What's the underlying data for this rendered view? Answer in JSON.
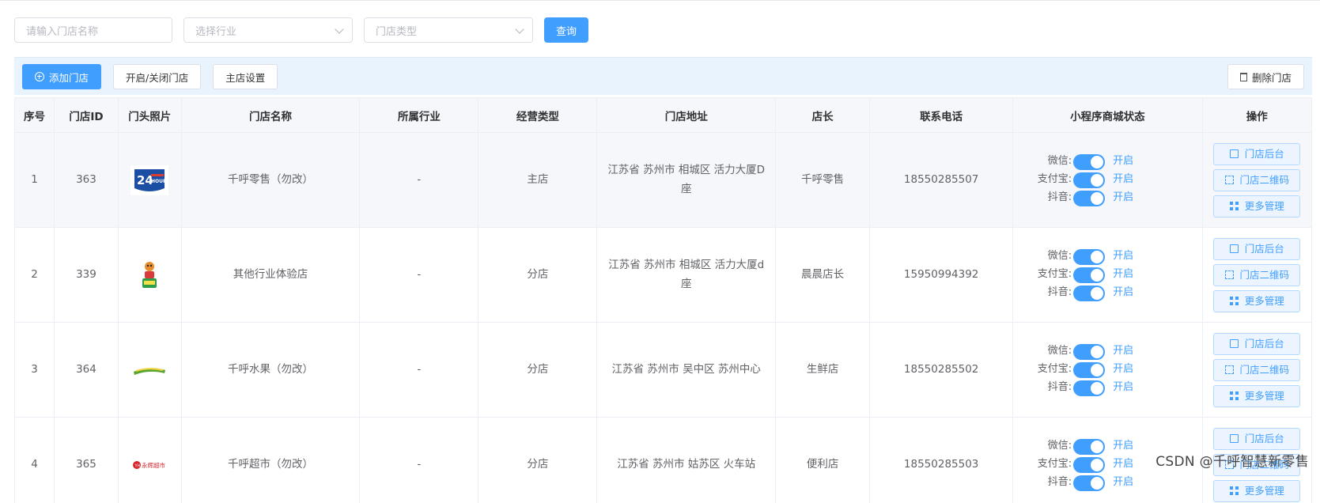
{
  "search": {
    "store_name_placeholder": "请输入门店名称",
    "industry_placeholder": "选择行业",
    "type_placeholder": "门店类型",
    "query_label": "查询"
  },
  "toolbar": {
    "add_label": "添加门店",
    "toggle_label": "开启/关闭门店",
    "main_store_label": "主店设置",
    "delete_label": "删除门店"
  },
  "table": {
    "headers": [
      "序号",
      "门店ID",
      "门头照片",
      "门店名称",
      "所属行业",
      "经营类型",
      "门店地址",
      "店长",
      "联系电话",
      "小程序商城状态",
      "操作"
    ],
    "rows": [
      {
        "no": "1",
        "id": "363",
        "name": "千呼零售（勿改）",
        "industry": "-",
        "type": "主店",
        "address": "江苏省 苏州市 相城区 活力大厦D座",
        "manager": "千呼零售",
        "phone": "18550285507"
      },
      {
        "no": "2",
        "id": "339",
        "name": "其他行业体验店",
        "industry": "-",
        "type": "分店",
        "address": "江苏省 苏州市 相城区 活力大厦d座",
        "manager": "晨晨店长",
        "phone": "15950994392"
      },
      {
        "no": "3",
        "id": "364",
        "name": "千呼水果（勿改）",
        "industry": "-",
        "type": "分店",
        "address": "江苏省 苏州市 吴中区 苏州中心",
        "manager": "生鲜店",
        "phone": "18550285502"
      },
      {
        "no": "4",
        "id": "365",
        "name": "千呼超市（勿改）",
        "industry": "-",
        "type": "分店",
        "address": "江苏省 苏州市 姑苏区 火车站",
        "manager": "便利店",
        "phone": "18550285503"
      }
    ],
    "status_labels": {
      "wechat": "微信:",
      "alipay": "支付宝:",
      "douyin": "抖音:",
      "on": "开启"
    },
    "actions": {
      "backend": "门店后台",
      "qrcode": "门店二维码",
      "more": "更多管理"
    }
  },
  "logos": {
    "row1": "24HOUR",
    "row4": "永辉超市"
  },
  "watermark": "CSDN @千呼智慧新零售",
  "colors": {
    "primary": "#409eff",
    "header_bg": "#f5f7fa",
    "toolbar_bg": "#e9f3fd"
  }
}
